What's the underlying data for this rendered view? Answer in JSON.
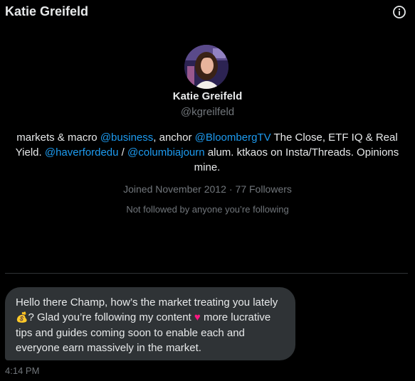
{
  "header": {
    "title": "Katie Greifeld",
    "info_icon": "info-icon"
  },
  "profile": {
    "name": "Katie Greifeld",
    "handle": "@kgreilfeld",
    "bio": {
      "t1": "markets & macro ",
      "m1": "@business",
      "t2": ", anchor ",
      "m2": "@BloombergTV",
      "t3": " The Close, ETF IQ & Real Yield. ",
      "m3": "@haverfordedu",
      "t4": " / ",
      "m4": "@columbiajourn",
      "t5": " alum. ktkaos on Insta/Threads. Opinions mine."
    },
    "joined": "Joined November 2012",
    "separator": "·",
    "followers": "77 Followers",
    "follow_note": "Not followed by anyone you’re following"
  },
  "message": {
    "p1": "Hello there Champ, how’s the market treating you lately",
    "emoji_moneybag": "💰",
    "p2": "? Glad you’re following my content ",
    "emoji_heart": "♥",
    "p3": " more lucrative tips and guides coming soon to enable each and everyone earn massively in the market.",
    "timestamp": "4:14 PM"
  },
  "colors": {
    "background": "#000000",
    "text": "#e7e9ea",
    "muted": "#71767b",
    "link": "#1d9bf0",
    "bubble": "#2f3336",
    "heart": "#f91880"
  }
}
